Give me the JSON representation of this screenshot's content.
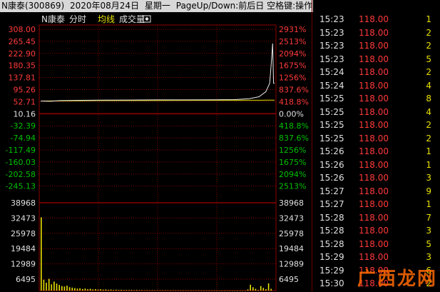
{
  "header": {
    "title": "N康泰(300869)",
    "date": "2020年08月24日",
    "weekday": "星期一",
    "hint": "PageUp/Down:前后日 空格键:操作"
  },
  "chart_header": {
    "name": "N康泰",
    "tabs": [
      "分时",
      "均线",
      "成交量"
    ]
  },
  "chart_data": {
    "type": "line",
    "title": "",
    "price_axis": {
      "left_labels": [
        "308.00",
        "265.45",
        "222.90",
        "180.35",
        "137.81",
        "95.26",
        "52.71",
        "10.16",
        "-32.39",
        "-74.94",
        "-117.49",
        "-160.03",
        "-202.58",
        "-245.13"
      ],
      "right_labels": [
        "2931%",
        "2513%",
        "2094%",
        "1675%",
        "1256%",
        "837.6%",
        "418.8%",
        "0.00%",
        "418.8%",
        "837.6%",
        "1256%",
        "1675%",
        "2094%",
        "2513%"
      ],
      "base": 10.16,
      "ylim": [
        -245.13,
        308.0
      ]
    },
    "price_series": [
      {
        "x": 0,
        "y": 55.0
      },
      {
        "x": 10,
        "y": 54.0
      },
      {
        "x": 20,
        "y": 56.5
      },
      {
        "x": 40,
        "y": 57.5
      },
      {
        "x": 60,
        "y": 58.0
      },
      {
        "x": 90,
        "y": 58.5
      },
      {
        "x": 120,
        "y": 59.0
      },
      {
        "x": 150,
        "y": 59.0
      },
      {
        "x": 180,
        "y": 59.5
      },
      {
        "x": 200,
        "y": 60.0
      },
      {
        "x": 215,
        "y": 63.0
      },
      {
        "x": 225,
        "y": 70.0
      },
      {
        "x": 232,
        "y": 88.0
      },
      {
        "x": 236,
        "y": 118.0
      },
      {
        "x": 238,
        "y": 205.0
      },
      {
        "x": 239,
        "y": 258.0
      },
      {
        "x": 240,
        "y": 118.0
      },
      {
        "x": 241,
        "y": 118.0
      }
    ],
    "avg_series": [
      {
        "x": 0,
        "y": 55.0
      },
      {
        "x": 60,
        "y": 56.5
      },
      {
        "x": 120,
        "y": 57.0
      },
      {
        "x": 180,
        "y": 57.5
      },
      {
        "x": 225,
        "y": 57.8
      },
      {
        "x": 235,
        "y": 58.0
      },
      {
        "x": 241,
        "y": 58.2
      }
    ],
    "volume_axis": {
      "labels": [
        "38968",
        "32473",
        "25978",
        "19484",
        "12989",
        "6495"
      ],
      "ylim": [
        0,
        38968
      ]
    },
    "volume": [
      32500,
      4800,
      3500,
      5200,
      2800,
      4000,
      3100,
      2500,
      2000,
      1800,
      2200,
      1500,
      1300,
      1100,
      900,
      1000,
      700,
      900,
      600,
      800,
      500,
      650,
      450,
      600,
      400,
      500,
      350,
      450,
      300,
      400,
      300,
      350,
      250,
      300,
      250,
      280,
      200,
      250,
      180,
      220,
      160,
      200,
      150,
      180,
      140,
      160,
      130,
      150,
      120,
      140,
      110,
      130,
      100,
      120,
      90,
      110,
      80,
      100,
      70,
      90,
      60,
      80,
      60,
      70,
      50,
      60,
      50,
      60,
      40,
      50,
      40,
      50,
      40,
      40,
      30,
      40,
      30,
      30,
      20,
      30,
      500,
      2600,
      1500,
      800,
      300,
      2000,
      1200,
      600,
      3200,
      800
    ],
    "colors": {
      "price": "#e8e8e8",
      "avg": "#e8e000",
      "up": "#ff3a3a",
      "down": "#00c000",
      "grid": "#8b0000",
      "volume": "#e8e000"
    }
  },
  "ticks": [
    {
      "time": "15:23",
      "price": "118.00",
      "vol": "1"
    },
    {
      "time": "15:23",
      "price": "118.00",
      "vol": "2"
    },
    {
      "time": "15:23",
      "price": "118.00",
      "vol": "2"
    },
    {
      "time": "15:23",
      "price": "118.00",
      "vol": "5"
    },
    {
      "time": "15:24",
      "price": "118.00",
      "vol": "2"
    },
    {
      "time": "15:24",
      "price": "118.00",
      "vol": "4"
    },
    {
      "time": "15:25",
      "price": "118.00",
      "vol": "8"
    },
    {
      "time": "15:25",
      "price": "118.00",
      "vol": "4"
    },
    {
      "time": "15:25",
      "price": "118.00",
      "vol": "2"
    },
    {
      "time": "15:25",
      "price": "118.00",
      "vol": "2"
    },
    {
      "time": "15:26",
      "price": "118.00",
      "vol": "1"
    },
    {
      "time": "15:26",
      "price": "118.00",
      "vol": "1"
    },
    {
      "time": "15:26",
      "price": "118.00",
      "vol": "3"
    },
    {
      "time": "15:27",
      "price": "118.00",
      "vol": "9"
    },
    {
      "time": "15:27",
      "price": "118.00",
      "vol": "1"
    },
    {
      "time": "15:28",
      "price": "118.00",
      "vol": "7"
    },
    {
      "time": "15:28",
      "price": "118.00",
      "vol": "3"
    },
    {
      "time": "15:28",
      "price": "118.00",
      "vol": "5"
    },
    {
      "time": "15:29",
      "price": "118.00",
      "vol": "3"
    },
    {
      "time": "15:29",
      "price": "118.00",
      "vol": "6"
    },
    {
      "time": "15:30",
      "price": "118.00",
      "vol": "2"
    }
  ],
  "watermark": "广西龙网"
}
